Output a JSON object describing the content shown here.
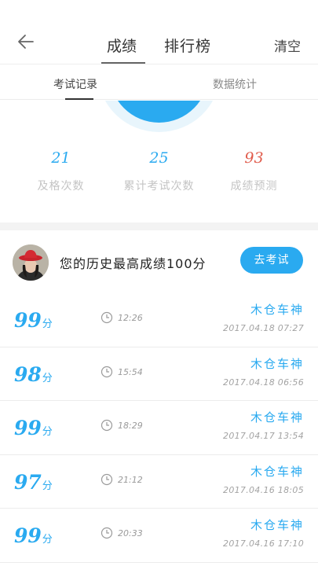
{
  "header": {
    "tabs": [
      "成绩",
      "排行榜"
    ],
    "active_tab": "成绩",
    "clear_label": "清空"
  },
  "subtabs": [
    "考试记录",
    "数据统计"
  ],
  "active_subtab": "考试记录",
  "stats": [
    {
      "value": "21",
      "label": "及格次数",
      "color": "#2aaaf0"
    },
    {
      "value": "25",
      "label": "累计考试次数",
      "color": "#2aaaf0"
    },
    {
      "value": "93",
      "label": "成绩预测",
      "color": "#e05a4a"
    }
  ],
  "profile": {
    "best_text": "您的历史最高成绩100分",
    "go_exam_label": "去考试"
  },
  "records": [
    {
      "score": "99",
      "unit": "分",
      "duration": "12:26",
      "user": "木仓车神",
      "datetime": "2017.04.18  07:27"
    },
    {
      "score": "98",
      "unit": "分",
      "duration": "15:54",
      "user": "木仓车神",
      "datetime": "2017.04.18  06:56"
    },
    {
      "score": "99",
      "unit": "分",
      "duration": "18:29",
      "user": "木仓车神",
      "datetime": "2017.04.17  13:54"
    },
    {
      "score": "97",
      "unit": "分",
      "duration": "21:12",
      "user": "木仓车神",
      "datetime": "2017.04.16  18:05"
    },
    {
      "score": "99",
      "unit": "分",
      "duration": "20:33",
      "user": "木仓车神",
      "datetime": "2017.04.16  17:10"
    }
  ],
  "colors": {
    "accent": "#2aaaf0",
    "predict": "#e05a4a"
  }
}
